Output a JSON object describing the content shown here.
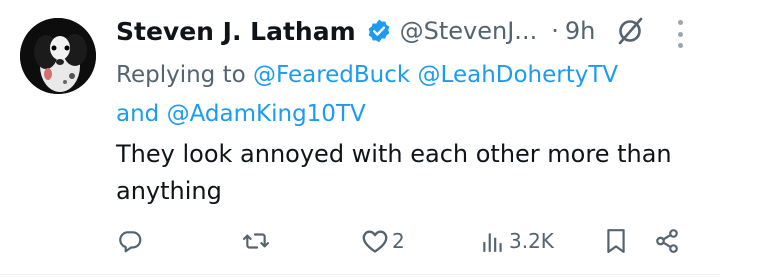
{
  "tweet": {
    "author_name": "Steven J. Latham",
    "handle": "@StevenJ...",
    "separator": "·",
    "time": "9h",
    "verified": true,
    "replying_prefix": "Replying to",
    "mentions": [
      "@FearedBuck",
      "@LeahDohertyTV"
    ],
    "mention_conjunction": "and",
    "last_mention": "@AdamKing10TV",
    "text": "They look annoyed with each other more than anything"
  },
  "actions": {
    "reply_icon": "reply-icon",
    "retweet_icon": "retweet-icon",
    "like_icon": "heart-icon",
    "like_count": "2",
    "views_icon": "views-bar-icon",
    "views_count": "3.2K",
    "bookmark_icon": "bookmark-icon",
    "share_icon": "share-icon"
  },
  "colors": {
    "link": "#1d9bf0",
    "secondary_text": "#536471",
    "primary_text": "#0f1419",
    "verified_badge": "#1d9bf0"
  }
}
